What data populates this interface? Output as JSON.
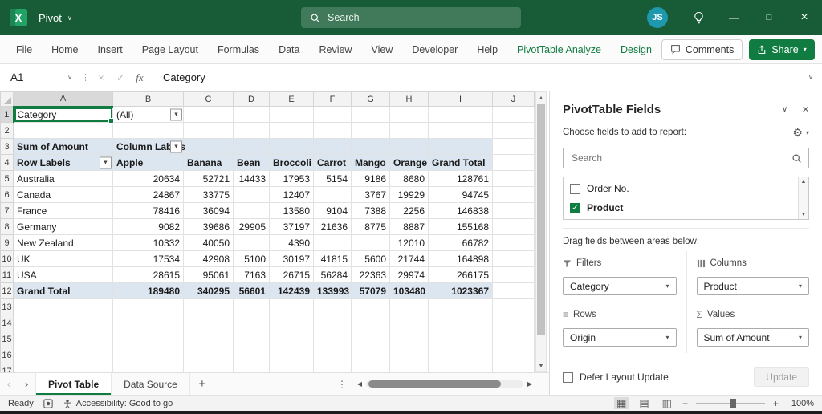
{
  "colors": {
    "titlebar": "#185C37",
    "accent_green": "#107C41",
    "pivot_blue": "#DCE6F1",
    "avatar": "#1E98AC"
  },
  "icons": {
    "dropdown_arrow": "▼",
    "small_dropdown": "▾",
    "chevron_down": "∨",
    "close": "×",
    "maximize": "□",
    "minimize": "—",
    "check": "✓",
    "cancel": "×",
    "fx": "fx",
    "grip": "⋮",
    "nav_left": "‹",
    "nav_right": "›",
    "scroll_up": "▲",
    "scroll_down": "▼",
    "scroll_left": "◀",
    "scroll_right": "▶",
    "gear": "⚙",
    "sigma": "Σ",
    "rows_glyph": "≡",
    "minus": "−",
    "plus": "+",
    "add_sheet": "+",
    "view_normal": "▦",
    "view_page_layout": "▤",
    "view_page_break": "▥"
  },
  "title_bar": {
    "app_name": "Pivot",
    "search_placeholder": "Search",
    "avatar_initials": "JS"
  },
  "ribbon": {
    "tabs": [
      "File",
      "Home",
      "Insert",
      "Page Layout",
      "Formulas",
      "Data",
      "Review",
      "View",
      "Developer",
      "Help",
      "PivotTable Analyze",
      "Design"
    ],
    "contextual_tabs": [
      "PivotTable Analyze",
      "Design"
    ],
    "comments_label": "Comments",
    "share_label": "Share"
  },
  "formula_bar": {
    "name_box": "A1",
    "value": "Category"
  },
  "sheet": {
    "columns": [
      "A",
      "B",
      "C",
      "D",
      "E",
      "F",
      "G",
      "H",
      "I",
      "J"
    ],
    "row_numbers": [
      1,
      2,
      3,
      4,
      5,
      6,
      7,
      8,
      9,
      10,
      11,
      12,
      13,
      14,
      15,
      16,
      17
    ],
    "selected_cell": {
      "row": 1,
      "col": "A"
    },
    "dropdowns": [
      {
        "row": 1,
        "col": "B",
        "name": "report-filter-dropdown"
      },
      {
        "row": 3,
        "col": "B",
        "name": "column-labels-filter-dropdown"
      },
      {
        "row": 4,
        "col": "A",
        "name": "row-labels-filter-dropdown"
      }
    ],
    "cells": {
      "1": {
        "A": "Category",
        "B": "(All)"
      },
      "3": {
        "A": "Sum of Amount",
        "B": "Column Labels"
      },
      "4": {
        "A": "Row Labels",
        "B": "Apple",
        "C": "Banana",
        "D": "Bean",
        "E": "Broccoli",
        "F": "Carrot",
        "G": "Mango",
        "H": "Orange",
        "I": "Grand Total"
      },
      "5": {
        "A": "Australia",
        "B": "20634",
        "C": "52721",
        "D": "14433",
        "E": "17953",
        "F": "5154",
        "G": "9186",
        "H": "8680",
        "I": "128761"
      },
      "6": {
        "A": "Canada",
        "B": "24867",
        "C": "33775",
        "E": "12407",
        "G": "3767",
        "H": "19929",
        "I": "94745"
      },
      "7": {
        "A": "France",
        "B": "78416",
        "C": "36094",
        "E": "13580",
        "F": "9104",
        "G": "7388",
        "H": "2256",
        "I": "146838"
      },
      "8": {
        "A": "Germany",
        "B": "9082",
        "C": "39686",
        "D": "29905",
        "E": "37197",
        "F": "21636",
        "G": "8775",
        "H": "8887",
        "I": "155168"
      },
      "9": {
        "A": "New Zealand",
        "B": "10332",
        "C": "40050",
        "E": "4390",
        "H": "12010",
        "I": "66782"
      },
      "10": {
        "A": "UK",
        "B": "17534",
        "C": "42908",
        "D": "5100",
        "E": "30197",
        "F": "41815",
        "G": "5600",
        "H": "21744",
        "I": "164898"
      },
      "11": {
        "A": "USA",
        "B": "28615",
        "C": "95061",
        "D": "7163",
        "E": "26715",
        "F": "56284",
        "G": "22363",
        "H": "29974",
        "I": "266175"
      },
      "12": {
        "A": "Grand Total",
        "B": "189480",
        "C": "340295",
        "D": "56601",
        "E": "142439",
        "F": "133993",
        "G": "57079",
        "H": "103480",
        "I": "1023367"
      }
    }
  },
  "sheet_tabs": {
    "tabs": [
      "Pivot Table",
      "Data Source"
    ]
  },
  "status_bar": {
    "ready": "Ready",
    "accessibility": "Accessibility: Good to go",
    "zoom_percent": "100%"
  },
  "fields_panel": {
    "title": "PivotTable Fields",
    "choose_fields_label": "Choose fields to add to report:",
    "search_placeholder": "Search",
    "fields": [
      {
        "name": "Order No.",
        "checked": false
      },
      {
        "name": "Product",
        "checked": true
      }
    ],
    "drag_label": "Drag fields between areas below:",
    "areas": [
      {
        "label": "Filters",
        "value": "Category"
      },
      {
        "label": "Columns",
        "value": "Product"
      },
      {
        "label": "Rows",
        "value": "Origin"
      },
      {
        "label": "Values",
        "value": "Sum of Amount"
      }
    ],
    "defer_label": "Defer Layout Update",
    "update_label": "Update"
  }
}
